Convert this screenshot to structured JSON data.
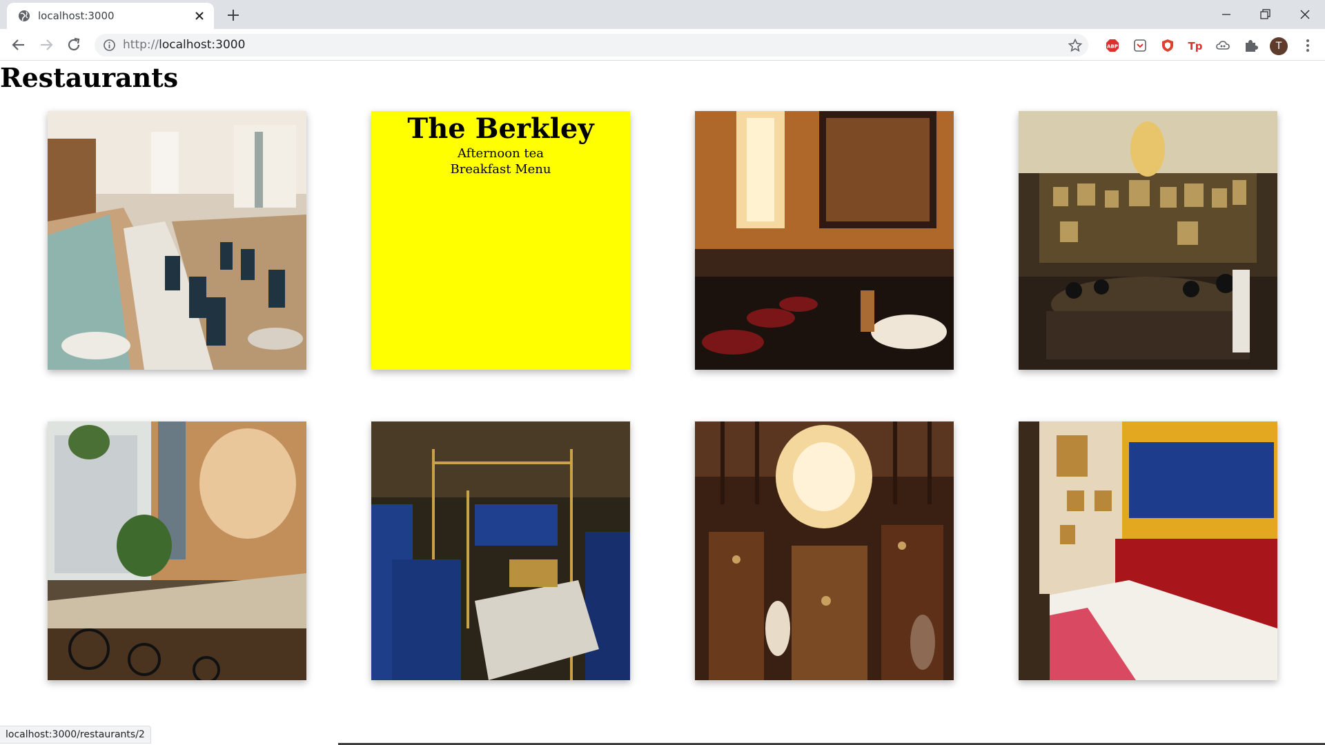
{
  "browser": {
    "tab_title": "localhost:3000",
    "url_scheme": "http://",
    "url_host": "localhost:3000",
    "avatar_letter": "T",
    "status_url": "localhost:3000/restaurants/2"
  },
  "page": {
    "title": "Restaurants"
  },
  "restaurants": [
    {
      "image": "restaurant-interior-photo-bright-dining-room"
    },
    {
      "name": "The Berkley",
      "menus": [
        "Afternoon tea",
        "Breakfast Menu"
      ],
      "background": "#ffff00"
    },
    {
      "image": "restaurant-interior-photo-bar-with-stools"
    },
    {
      "image": "restaurant-interior-photo-ornate-hall-with-chandelier"
    },
    {
      "image": "restaurant-interior-photo-cafe-with-mural"
    },
    {
      "image": "restaurant-interior-photo-blue-velvet-booths"
    },
    {
      "image": "restaurant-interior-photo-bar-with-crystal-chandelier"
    },
    {
      "image": "restaurant-interior-photo-bistro-with-red-banquette"
    }
  ]
}
